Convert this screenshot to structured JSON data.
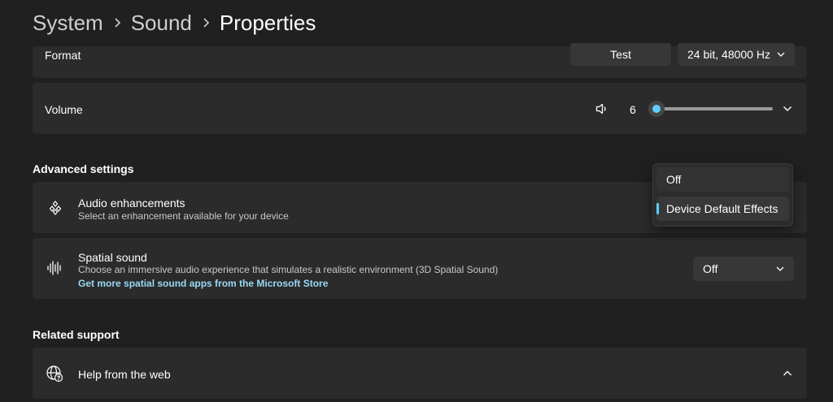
{
  "breadcrumb": {
    "items": [
      "System",
      "Sound"
    ],
    "current": "Properties"
  },
  "format": {
    "label": "Format",
    "test_label": "Test",
    "selected_value": "24 bit, 48000 Hz"
  },
  "volume": {
    "label": "Volume",
    "value": "6",
    "level": 0.06
  },
  "advanced": {
    "title": "Advanced settings",
    "audio_enhancements": {
      "title": "Audio enhancements",
      "subtitle": "Select an enhancement available for your device",
      "menu_options": [
        "Off",
        "Device Default Effects"
      ],
      "selected_option": "Device Default Effects"
    },
    "spatial_sound": {
      "title": "Spatial sound",
      "subtitle": "Choose an immersive audio experience that simulates a realistic environment (3D Spatial Sound)",
      "link": "Get more spatial sound apps from the Microsoft Store",
      "selected_value": "Off"
    }
  },
  "related": {
    "title": "Related support",
    "help_label": "Help from the web"
  },
  "colors": {
    "accent": "#60cdff",
    "link": "#99d9f5",
    "background": "#202020",
    "card": "#2b2b2b"
  },
  "icons": [
    "chevron-right-icon",
    "chevron-down-icon",
    "chevron-up-icon",
    "speaker-icon",
    "audio-enhancements-icon",
    "spatial-sound-icon",
    "globe-help-icon"
  ]
}
